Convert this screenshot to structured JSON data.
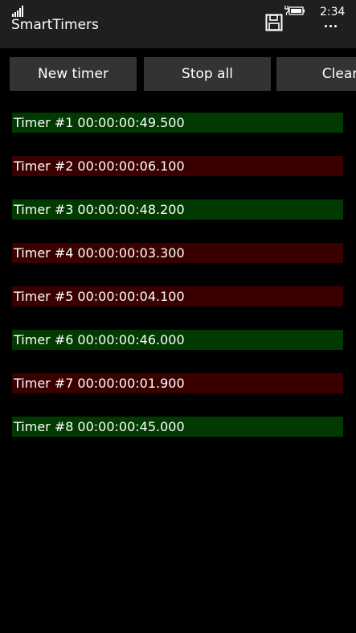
{
  "status_bar": {
    "time": "2:34",
    "signal_icon": "signal-bars-icon",
    "battery_icon": "battery-charging-icon"
  },
  "app": {
    "title": "SmartTimers",
    "save_icon": "save-disk-icon",
    "more_icon": "more-dots-icon"
  },
  "toolbar": {
    "new_timer_label": "New timer",
    "stop_all_label": "Stop all",
    "clear_label": "Clear"
  },
  "colors": {
    "running": "#003a00",
    "stopped": "#3a0000",
    "button_bg": "#333333",
    "titlebar_bg": "#1f1f1f"
  },
  "timers": [
    {
      "name": "Timer #1",
      "time": "00:00:00:49.500",
      "state": "running"
    },
    {
      "name": "Timer #2",
      "time": "00:00:00:06.100",
      "state": "stopped"
    },
    {
      "name": "Timer #3",
      "time": "00:00:00:48.200",
      "state": "running"
    },
    {
      "name": "Timer #4",
      "time": "00:00:00:03.300",
      "state": "stopped"
    },
    {
      "name": "Timer #5",
      "time": "00:00:00:04.100",
      "state": "stopped"
    },
    {
      "name": "Timer #6",
      "time": "00:00:00:46.000",
      "state": "running"
    },
    {
      "name": "Timer #7",
      "time": "00:00:00:01.900",
      "state": "stopped"
    },
    {
      "name": "Timer #8",
      "time": "00:00:00:45.000",
      "state": "running"
    }
  ]
}
